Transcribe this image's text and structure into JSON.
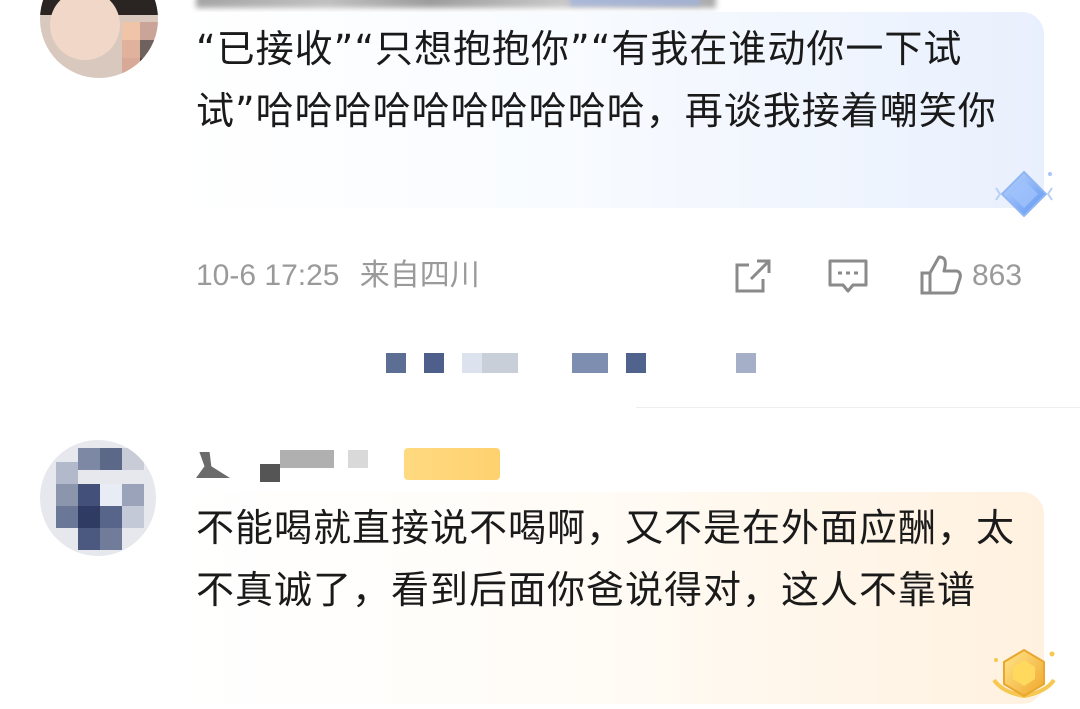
{
  "comment1": {
    "text": "“已接收”“只想抱抱你”“有我在谁动你一下试试”哈哈哈哈哈哈哈哈哈哈，再谈我接着嘲笑你",
    "time": "10-6 17:25",
    "location": "来自四川",
    "like_count": "863",
    "icons": [
      "share-icon",
      "comment-icon",
      "like-icon",
      "diamond-badge-icon"
    ],
    "bubble_accent": "#e9f0fd"
  },
  "comment2": {
    "text": "不能喝就直接说不喝啊，又不是在外面应酬，太不真诚了，看到后面你爸说得对，这人不靠谱",
    "icons": [
      "gold-badge-icon"
    ],
    "bubble_accent": "#fff1df"
  },
  "colors": {
    "meta_gray": "#9a9a9a",
    "text": "#1a1a1a",
    "diamond_blue": "#6fa6f5",
    "gold": "#f4b73b"
  }
}
